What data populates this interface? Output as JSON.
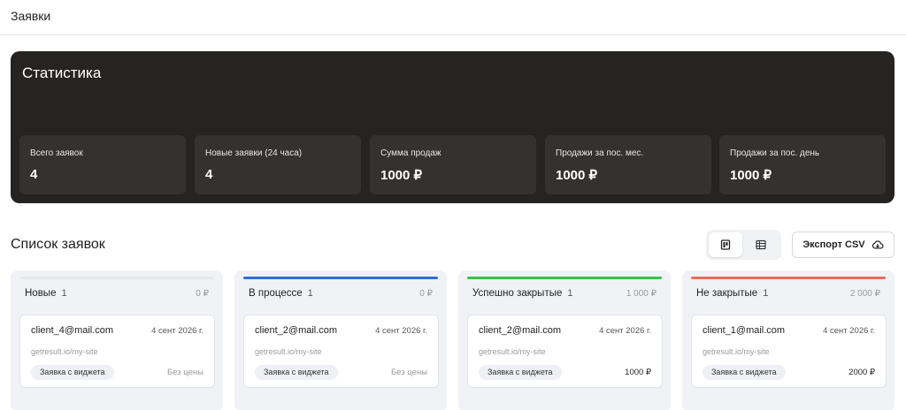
{
  "header": {
    "title": "Заявки"
  },
  "stats": {
    "title": "Статистика",
    "cards": [
      {
        "label": "Всего заявок",
        "value": "4"
      },
      {
        "label": "Новые заявки (24 часа)",
        "value": "4"
      },
      {
        "label": "Сумма продаж",
        "value": "1000 ₽"
      },
      {
        "label": "Продажи за пос. мес.",
        "value": "1000 ₽"
      },
      {
        "label": "Продажи за пос. день",
        "value": "1000 ₽"
      }
    ]
  },
  "list": {
    "title": "Список заявок",
    "view_icons": [
      "board-view-icon",
      "table-view-icon"
    ],
    "export_label": "Экспорт CSV",
    "export_icon": "cloud-download-icon"
  },
  "columns": [
    {
      "name": "Новые",
      "count": "1",
      "sum": "0 ₽",
      "color": "#e6e7ea",
      "card": {
        "email": "client_4@mail.com",
        "date": "4 сент 2026 г.",
        "site": "getresult.io/my-site",
        "tag": "Заявка с виджета",
        "price": "Без цены"
      }
    },
    {
      "name": "В процессе",
      "count": "1",
      "sum": "0 ₽",
      "color": "#2e6fdc",
      "card": {
        "email": "client_2@mail.com",
        "date": "4 сент 2026 г.",
        "site": "getresult.io/my-site",
        "tag": "Заявка с виджета",
        "price": "Без цены"
      }
    },
    {
      "name": "Успешно закрытые",
      "count": "1",
      "sum": "1 000 ₽",
      "color": "#35c24a",
      "card": {
        "email": "client_2@mail.com",
        "date": "4 сент 2026 г.",
        "site": "getresult.io/my-site",
        "tag": "Заявка с виджета",
        "price": "1000 ₽"
      }
    },
    {
      "name": "Не закрытые",
      "count": "1",
      "sum": "2 000 ₽",
      "color": "#ec6a5c",
      "card": {
        "email": "client_1@mail.com",
        "date": "4 сент 2026 г.",
        "site": "getresult.io/my-site",
        "tag": "Заявка с виджета",
        "price": "2000 ₽"
      }
    }
  ]
}
